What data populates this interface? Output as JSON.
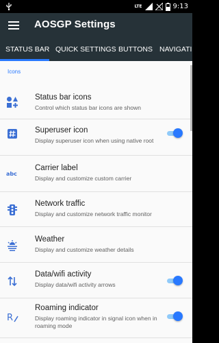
{
  "status_bar": {
    "network": "LTE",
    "time": "9:13"
  },
  "toolbar": {
    "title": "AOSGP Settings"
  },
  "tabs": [
    {
      "label": "STATUS BAR",
      "active": true
    },
    {
      "label": "QUICK SETTINGS",
      "active": false
    },
    {
      "label": "BUTTONS",
      "active": false
    },
    {
      "label": "NAVIGATIO",
      "active": false
    }
  ],
  "section": {
    "category": "Icons",
    "items": [
      {
        "title": "Status bar icons",
        "summary": "Control which status bar icons are shown",
        "icon": "shapes-icon",
        "toggle": false
      },
      {
        "title": "Superuser icon",
        "summary": "Display superuser icon when using native root",
        "icon": "hash-icon",
        "toggle": true
      },
      {
        "title": "Carrier label",
        "summary": "Display and customize custom carrier",
        "icon": "abc-text-icon",
        "toggle": false
      },
      {
        "title": "Network traffic",
        "summary": "Display and customize network traffic monitor",
        "icon": "traffic-light-icon",
        "toggle": false
      },
      {
        "title": "Weather",
        "summary": "Display and customize weather details",
        "icon": "weather-icon",
        "toggle": false
      },
      {
        "title": "Data/wifi activity",
        "summary": "Display data/wifi activity arrows",
        "icon": "arrows-icon",
        "toggle": true
      },
      {
        "title": "Roaming indicator",
        "summary": "Display roaming indicator in signal icon when in roaming mode",
        "icon": "roaming-r-icon",
        "toggle": true
      }
    ]
  },
  "colors": {
    "toolbar_bg": "#263238",
    "accent": "#2979ff",
    "content_bg": "#fafafa"
  }
}
